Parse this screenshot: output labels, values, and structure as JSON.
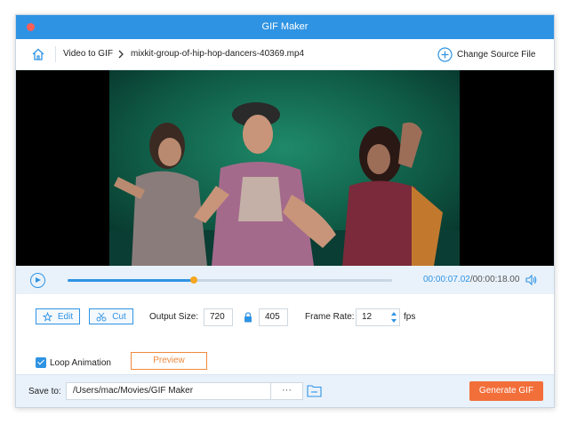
{
  "window": {
    "title": "GIF Maker"
  },
  "breadcrumb": {
    "section": "Video to GIF",
    "file": "mixkit-group-of-hip-hop-dancers-40369.mp4",
    "change_source_label": "Change Source File"
  },
  "player": {
    "current_time": "00:00:07.02",
    "total_time": "/00:00:18.00",
    "progress": 0.39
  },
  "controls": {
    "edit_label": "Edit",
    "cut_label": "Cut",
    "output_size_label": "Output Size:",
    "width": "720",
    "height": "405",
    "frame_rate_label": "Frame Rate:",
    "frame_rate": "12",
    "fps_label": "fps",
    "loop_label": "Loop Animation",
    "loop_checked": true,
    "preview_label": "Preview"
  },
  "save": {
    "label": "Save to:",
    "path": "/Users/mac/Movies/GIF Maker",
    "more_label": "···",
    "generate_label": "Generate GIF"
  },
  "colors": {
    "accent": "#2f93e3",
    "generate": "#f26f3a",
    "preview": "#f08a3c",
    "knob": "#f5a623"
  },
  "icons": [
    "home-icon",
    "chevron-right-icon",
    "add-circle-icon",
    "play-icon",
    "volume-icon",
    "edit-icon",
    "scissors-icon",
    "lock-icon",
    "stepper-icon",
    "folder-icon"
  ]
}
